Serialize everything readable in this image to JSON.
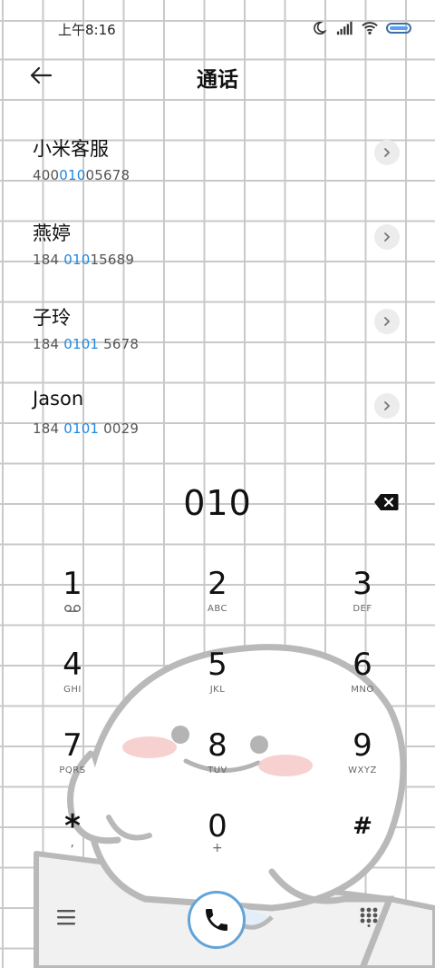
{
  "status": {
    "time": "上午8:16"
  },
  "header": {
    "title": "通话"
  },
  "contacts": [
    {
      "name": "小米客服",
      "num_pre": "400",
      "num_hl": "010",
      "num_post": "05678"
    },
    {
      "name": "燕婷",
      "num_pre": "184 ",
      "num_hl": "010",
      "num_post": "15689"
    },
    {
      "name": "子玲",
      "num_pre": "184 ",
      "num_hl": "0101",
      "num_post": " 5678"
    },
    {
      "name": "Jason",
      "num_pre": "184 ",
      "num_hl": "0101",
      "num_post": " 0029"
    }
  ],
  "dialer": {
    "input": "010",
    "keys": [
      {
        "digit": "1",
        "letters": ""
      },
      {
        "digit": "2",
        "letters": "ABC"
      },
      {
        "digit": "3",
        "letters": "DEF"
      },
      {
        "digit": "4",
        "letters": "GHI"
      },
      {
        "digit": "5",
        "letters": "JKL"
      },
      {
        "digit": "6",
        "letters": "MNO"
      },
      {
        "digit": "7",
        "letters": "PQRS"
      },
      {
        "digit": "8",
        "letters": "TUV"
      },
      {
        "digit": "9",
        "letters": "WXYZ"
      },
      {
        "digit": "*",
        "letters": ","
      },
      {
        "digit": "0",
        "letters": "+"
      },
      {
        "digit": "#",
        "letters": ""
      }
    ]
  },
  "icons": {
    "back": "arrow-left-icon",
    "backspace": "backspace-icon",
    "menu": "menu-icon",
    "call": "phone-icon",
    "keypad": "dialpad-icon",
    "voicemail": "voicemail-icon"
  },
  "colors": {
    "highlight": "#1e88e5",
    "call_ring": "#62a4d8"
  }
}
